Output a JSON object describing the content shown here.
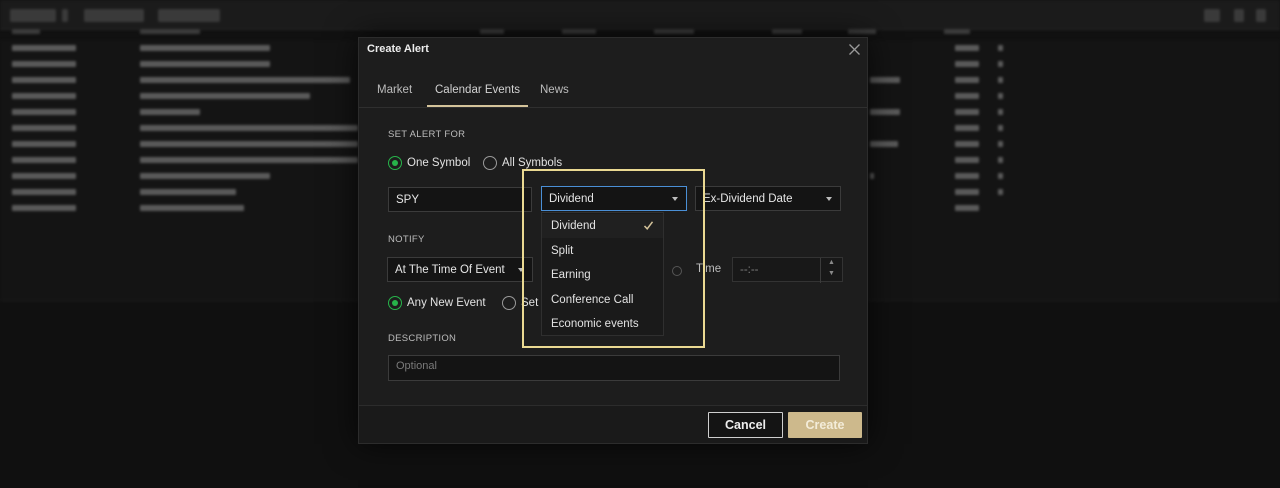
{
  "dialog": {
    "title": "Create Alert",
    "tabs": [
      {
        "label": "Market"
      },
      {
        "label": "Calendar Events"
      },
      {
        "label": "News"
      }
    ],
    "set_alert_for": {
      "section_label": "SET ALERT FOR",
      "option_one_symbol": "One Symbol",
      "option_all_symbols": "All Symbols",
      "selected": "One Symbol"
    },
    "symbol_field": {
      "value": "SPY"
    },
    "event_type_select": {
      "value": "Dividend"
    },
    "date_type_select": {
      "value": "Ex-Dividend Date"
    },
    "event_type_menu": {
      "items": [
        {
          "label": "Dividend",
          "selected": true
        },
        {
          "label": "Split"
        },
        {
          "label": "Earning"
        },
        {
          "label": "Conference Call"
        },
        {
          "label": "Economic events"
        }
      ]
    },
    "notify": {
      "section_label": "NOTIFY",
      "timing_select": {
        "value": "At The Time Of Event"
      },
      "time_label": "Time",
      "time_field": {
        "value": "--:--"
      },
      "option_any_new_event": "Any New Event",
      "option_partial": "Set",
      "selected": "Any New Event"
    },
    "description": {
      "section_label": "DESCRIPTION",
      "placeholder": "Optional"
    },
    "buttons": {
      "cancel": "Cancel",
      "create": "Create"
    }
  },
  "colors": {
    "accent_gold": "#cdb98c",
    "radio_green": "#27b44a",
    "focus_blue": "#4a8fd6",
    "highlight_yellow": "#ead992"
  },
  "icons": [
    "close-icon",
    "caret-down-icon",
    "check-icon"
  ]
}
